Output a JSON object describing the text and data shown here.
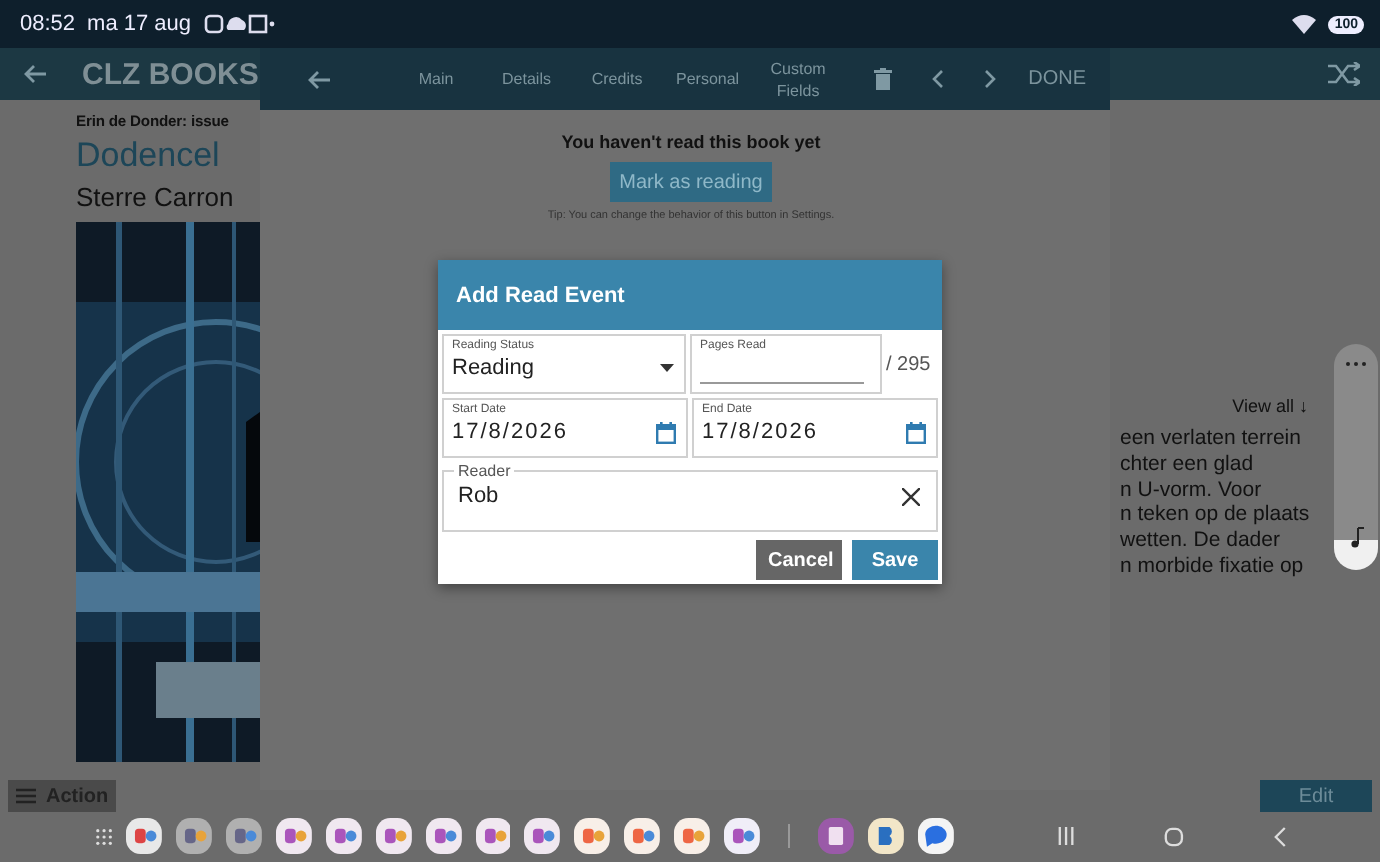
{
  "status_bar": {
    "time": "08:52",
    "date": "ma 17 aug",
    "battery": "100"
  },
  "app": {
    "title": "CLZ BOOKS",
    "series": "Erin de Donder: issue",
    "book_title": "Dodencel",
    "author": "Sterre Carron",
    "view_all": "View all ↓",
    "description_lines": [
      "een verlaten terrein",
      "chter een glad",
      "n U-vorm. Voor",
      "n teken op de plaats",
      "wetten. De dader",
      "n morbide fixatie op"
    ],
    "action_button": "Action",
    "edit_button": "Edit"
  },
  "edit_panel": {
    "tabs": [
      {
        "label": "Main",
        "selected": false
      },
      {
        "label": "Details",
        "selected": false
      },
      {
        "label": "Credits",
        "selected": false
      },
      {
        "label": "Personal",
        "selected": false
      },
      {
        "label": "Custom Fields",
        "selected": false
      }
    ],
    "done": "DONE",
    "message": "You haven't read this book yet",
    "mark_button": "Mark as reading",
    "tip": "Tip: You can change the behavior of this button in Settings."
  },
  "dialog": {
    "title": "Add Read Event",
    "reading_status": {
      "label": "Reading Status",
      "value": "Reading"
    },
    "pages_read": {
      "label": "Pages Read",
      "total": "/ 295"
    },
    "start_date": {
      "label": "Start Date",
      "value": "17/8/2026"
    },
    "end_date": {
      "label": "End Date",
      "value": "17/8/2026"
    },
    "reader": {
      "label": "Reader",
      "value": "Rob"
    },
    "buttons": [
      {
        "label": "Cancel",
        "kind": "secondary"
      },
      {
        "label": "Save",
        "kind": "primary"
      }
    ]
  }
}
